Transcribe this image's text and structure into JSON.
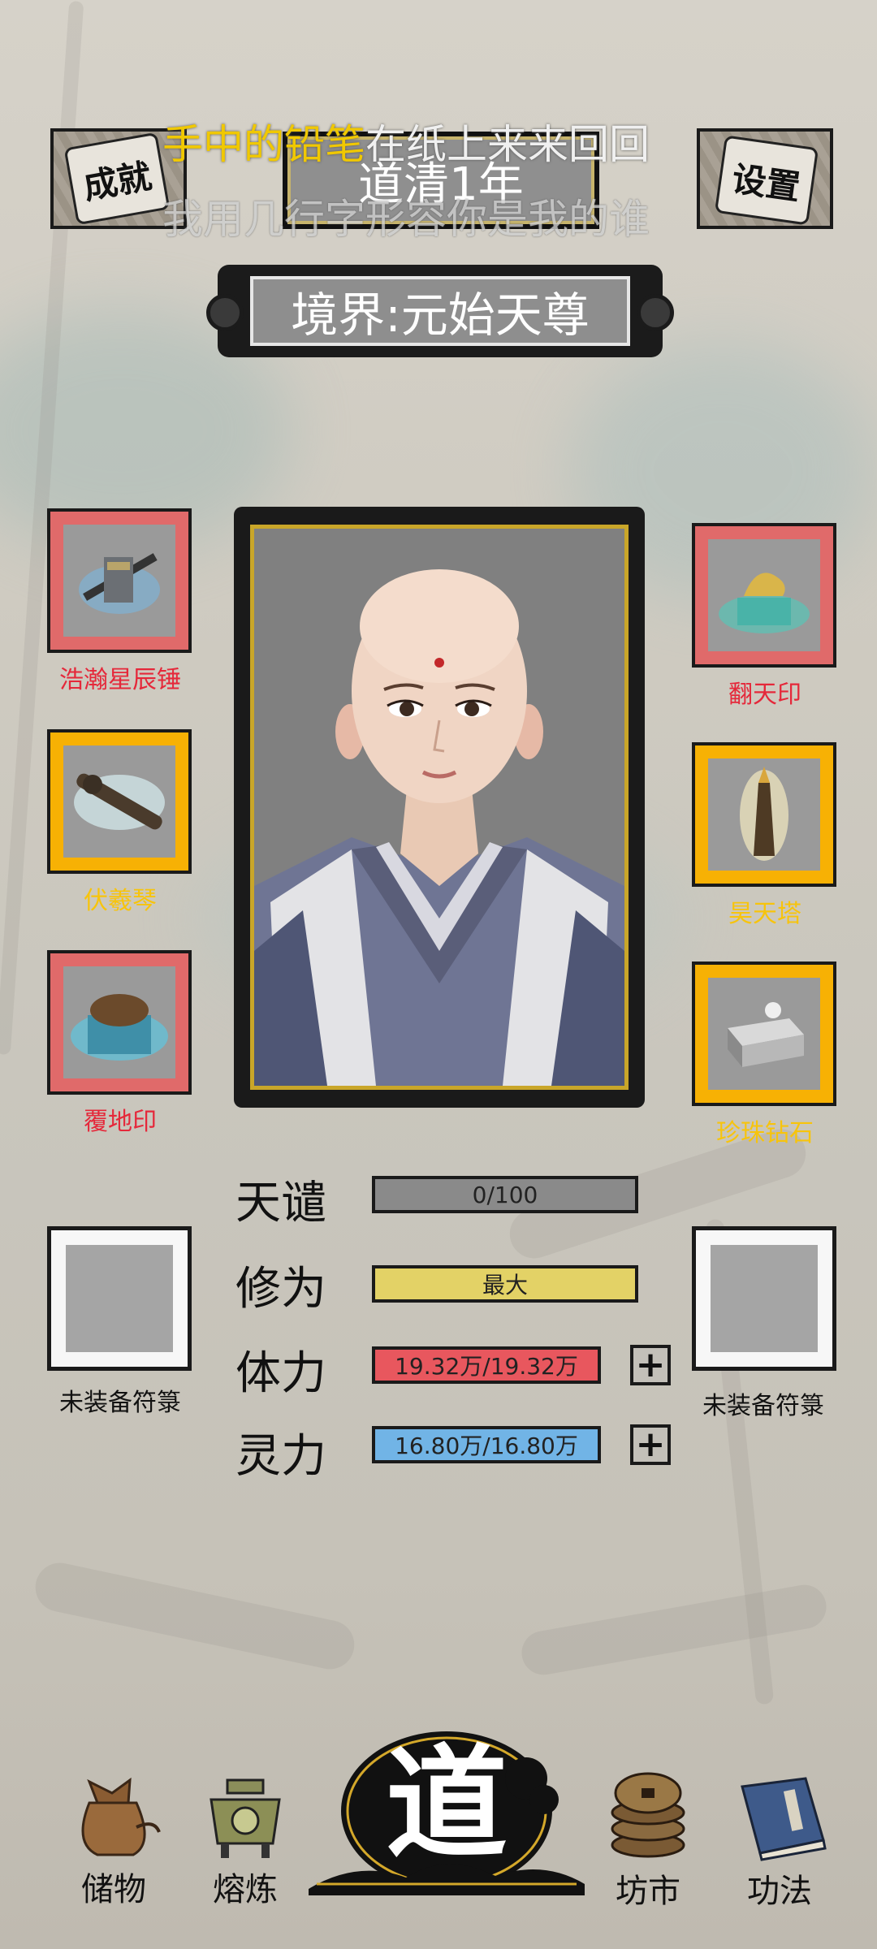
{
  "header": {
    "achievement_label": "成就",
    "settings_label": "设置",
    "year": "道清1年",
    "lyric_highlight": "手中的铅笔",
    "lyric_rest": "在纸上来来回回",
    "lyric_line2": "我用几行字形容你是我的谁"
  },
  "realm": {
    "text": "境界:元始天尊"
  },
  "equipment": {
    "left": [
      {
        "name": "浩瀚星辰锤",
        "rarity": "red"
      },
      {
        "name": "伏羲琴",
        "rarity": "gold"
      },
      {
        "name": "覆地印",
        "rarity": "red"
      }
    ],
    "right": [
      {
        "name": "翻天印",
        "rarity": "red"
      },
      {
        "name": "昊天塔",
        "rarity": "gold"
      },
      {
        "name": "珍珠钻石",
        "rarity": "gold"
      }
    ]
  },
  "talismans": {
    "left_label": "未装备符箓",
    "right_label": "未装备符箓"
  },
  "stats": {
    "tianqian": {
      "label": "天谴",
      "value": "0/100",
      "fraction": 0
    },
    "xiuwei": {
      "label": "修为",
      "value": "最大",
      "fraction": 1
    },
    "tili": {
      "label": "体力",
      "value": "19.32万/19.32万",
      "fraction": 1
    },
    "lingli": {
      "label": "灵力",
      "value": "16.80万/16.80万",
      "fraction": 1
    }
  },
  "nav": {
    "storage": "储物",
    "smelt": "熔炼",
    "dao": "道",
    "market": "坊市",
    "skills": "功法"
  },
  "colors": {
    "rarity_red": "#e06a6a",
    "rarity_gold": "#f7b104",
    "label_red": "#e5283a",
    "label_gold": "#f7c40c",
    "bar_grey": "#8a8a8a",
    "bar_yellow": "#e3d266",
    "bar_red": "#e8575e",
    "bar_blue": "#71b4e6"
  }
}
